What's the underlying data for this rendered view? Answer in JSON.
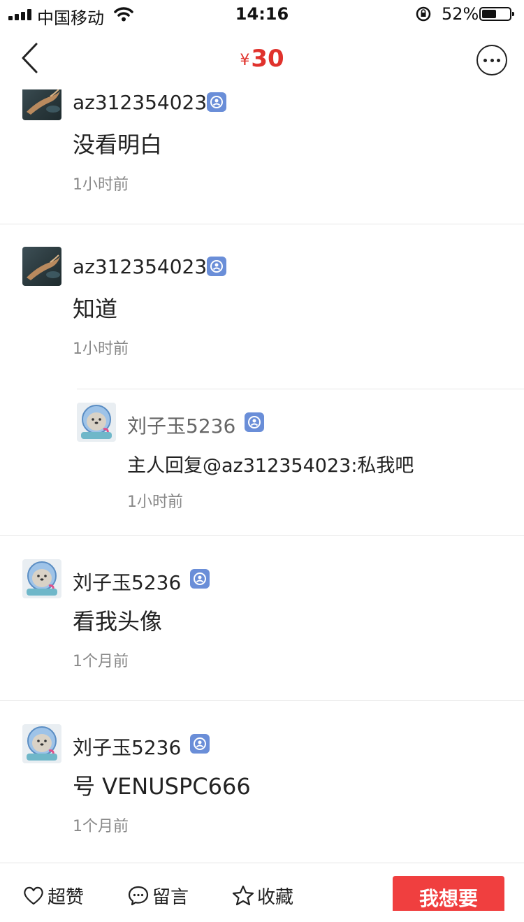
{
  "status_bar": {
    "carrier": "中国移动",
    "time": "14:16",
    "battery_percent_label": "52%",
    "battery_level": 0.52
  },
  "nav": {
    "currency": "¥",
    "price": "30"
  },
  "comments": [
    {
      "user": "az312354023",
      "text": "没看明白",
      "time": "1小时前"
    },
    {
      "user": "az312354023",
      "text": "知道",
      "time": "1小时前"
    },
    {
      "user": "刘子玉5236",
      "text": "主人回复@az312354023:私我吧",
      "time": "1小时前"
    },
    {
      "user": "刘子玉5236",
      "text": "看我头像",
      "time": "1个月前"
    },
    {
      "user": "刘子玉5236",
      "text": "号 VENUSPC666",
      "time": "1个月前"
    }
  ],
  "bottom_bar": {
    "like_label": "超赞",
    "comment_label": "留言",
    "favorite_label": "收藏",
    "want_label": "我想要"
  },
  "colors": {
    "price": "#e0322c",
    "want_button": "#f03f3f",
    "verified_badge": "#6a8ed8"
  }
}
